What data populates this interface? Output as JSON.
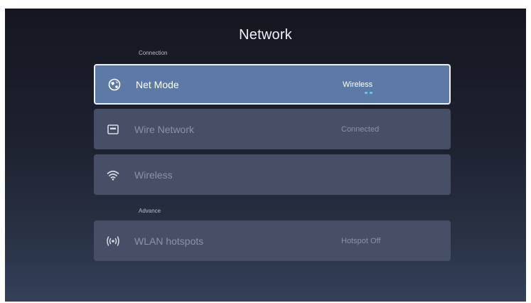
{
  "page": {
    "title": "Network"
  },
  "sections": {
    "connection": "Connection",
    "advance": "Advance"
  },
  "rows": [
    {
      "label": "Net Mode",
      "value": "Wireless",
      "icon": "globe-icon",
      "focused": true
    },
    {
      "label": "Wire Network",
      "value": "Connected",
      "icon": "ethernet-icon",
      "focused": false
    },
    {
      "label": "Wireless",
      "value": "",
      "icon": "wifi-icon",
      "focused": false
    },
    {
      "label": "WLAN hotspots",
      "value": "Hotspot Off",
      "icon": "hotspot-icon",
      "focused": false
    }
  ],
  "colors": {
    "focused_row": "#5d7aa6",
    "row": "#474f66",
    "accent_dots": "#58c8ff"
  }
}
